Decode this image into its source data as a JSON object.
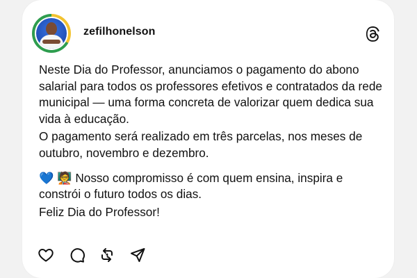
{
  "post": {
    "username": "zefilhonelson",
    "paragraphs": [
      "Neste Dia do Professor, anunciamos o pagamento do abono salarial para todos os professores efetivos e contratados da rede municipal — uma forma concreta de valorizar quem dedica sua vida à educação.",
      "O pagamento será realizado em três parcelas, nos meses de outubro, novembro e dezembro.",
      "💙 🧑‍🏫 Nosso compromisso é com quem ensina, inspira e constrói o futuro todos os dias.",
      "Feliz Dia do Professor!"
    ]
  },
  "icons": {
    "platform": "threads-icon",
    "actions": [
      "heart-icon",
      "comment-icon",
      "repost-icon",
      "share-icon"
    ]
  },
  "colors": {
    "card_background": "#ffffff",
    "page_background": "#f2f2f2",
    "text": "#111111",
    "avatar_ring_green": "#2e9d4e",
    "avatar_ring_yellow": "#f2c230",
    "avatar_background_blue": "#1f4fb8"
  }
}
